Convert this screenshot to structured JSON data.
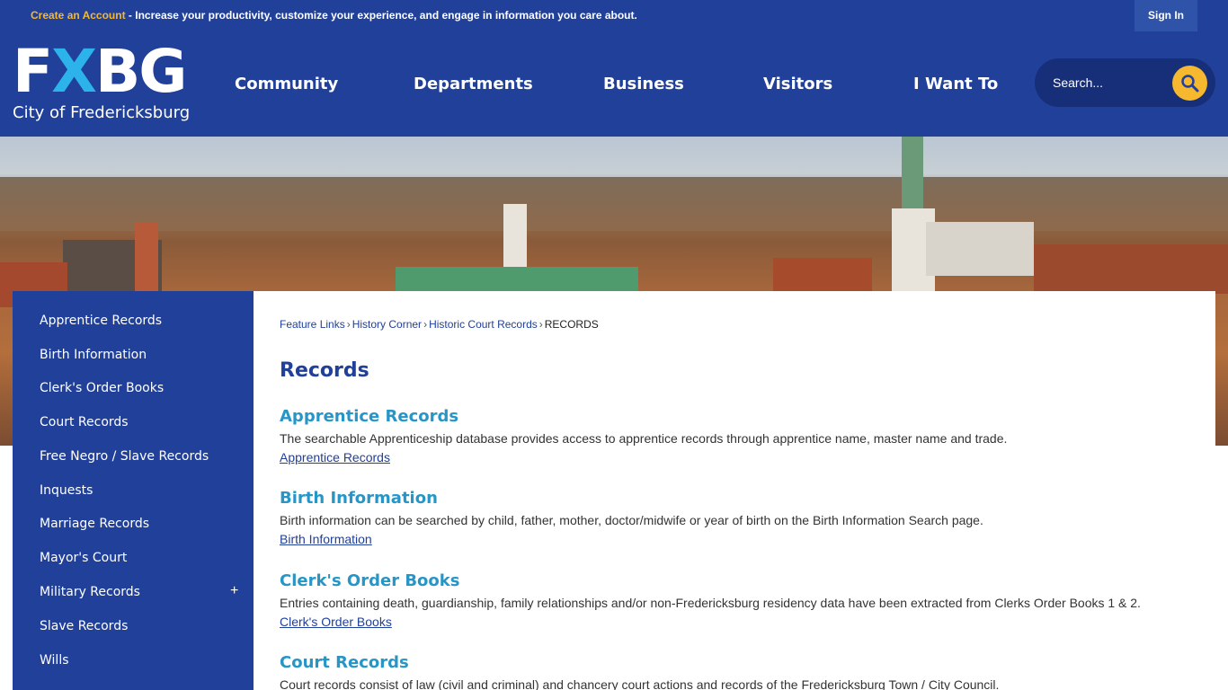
{
  "topbar": {
    "create_account": "Create an Account",
    "message": " - Increase your productivity, customize your experience, and engage in information you care about.",
    "sign_in": "Sign In"
  },
  "header": {
    "logo_mark_left": "F",
    "logo_mark_x": "X",
    "logo_mark_right": "BG",
    "logo_city": "City of Fredericksburg",
    "nav": [
      "Community",
      "Departments",
      "Business",
      "Visitors",
      "I Want To"
    ],
    "search_placeholder": "Search..."
  },
  "sidebar": {
    "items": [
      "Apprentice Records",
      "Birth Information",
      "Clerk's Order Books",
      "Court Records",
      "Free Negro / Slave Records",
      "Inquests",
      "Marriage Records",
      "Mayor's Court",
      "Military Records",
      "Slave Records",
      "Wills"
    ],
    "expand_symbol": "+"
  },
  "breadcrumb": {
    "items": [
      "Feature Links",
      "History Corner",
      "Historic Court Records"
    ],
    "separator": "›",
    "current": "RECORDS"
  },
  "page_title": "Records",
  "records": [
    {
      "title": "Apprentice Records",
      "description": "The searchable Apprenticeship database provides access to apprentice records through apprentice name, master name and trade.",
      "link": "Apprentice Records"
    },
    {
      "title": "Birth Information",
      "description": "Birth information can be searched by child, father, mother, doctor/midwife or year of birth on the Birth Information Search page.",
      "link": "Birth Information"
    },
    {
      "title": "Clerk's Order Books",
      "description": "Entries containing death, guardianship, family relationships and/or non-Fredericksburg residency data have been extracted from Clerks Order Books 1 & 2.",
      "link": "Clerk's Order Books"
    },
    {
      "title": "Court Records",
      "description": "Court records consist of law (civil and criminal) and chancery court actions and records of the Fredericksburg Town / City Council.",
      "link": ""
    }
  ],
  "icons": {
    "search": "search-icon",
    "plus": "plus-icon"
  },
  "colors": {
    "brand_blue": "#21409a",
    "accent_gold": "#f5b82e",
    "logo_cyan": "#2cb3ec",
    "record_title": "#2796c7"
  }
}
